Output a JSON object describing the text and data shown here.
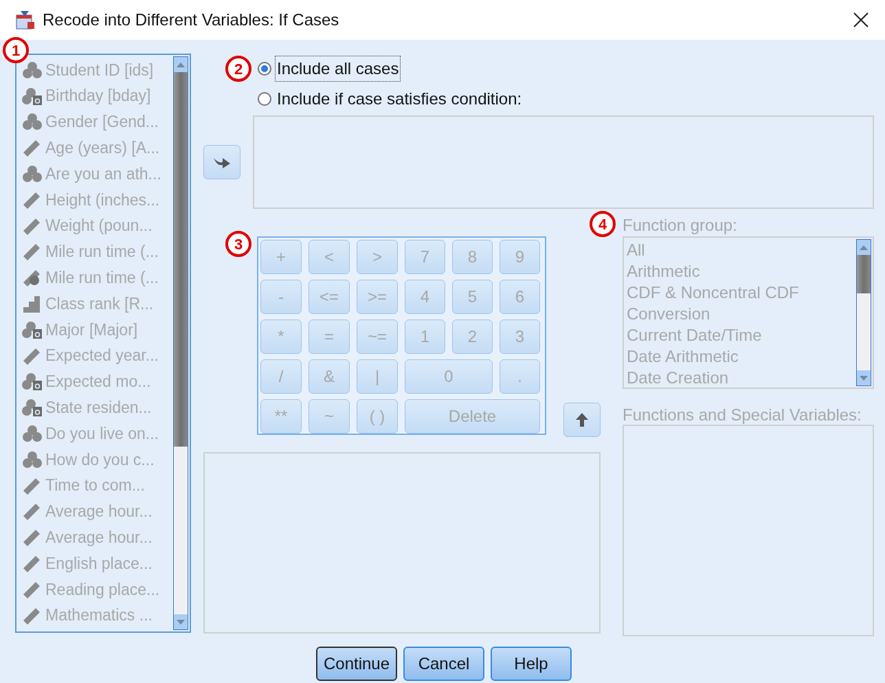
{
  "window": {
    "title": "Recode into Different Variables: If Cases"
  },
  "variables": {
    "badge": "1",
    "disabled": true,
    "items": [
      {
        "name": "Student ID [ids]",
        "kind": "nominal"
      },
      {
        "name": "Birthday [bday]",
        "kind": "string"
      },
      {
        "name": "Gender [Gend...",
        "kind": "nominal"
      },
      {
        "name": "Age (years) [A...",
        "kind": "scale"
      },
      {
        "name": "Are you an ath...",
        "kind": "nominal"
      },
      {
        "name": "Height (inches...",
        "kind": "scale"
      },
      {
        "name": "Weight (poun...",
        "kind": "scale"
      },
      {
        "name": "Mile run time (...",
        "kind": "scale"
      },
      {
        "name": "Mile run time (...",
        "kind": "date"
      },
      {
        "name": "Class rank [R...",
        "kind": "ordinal"
      },
      {
        "name": "Major [Major]",
        "kind": "string"
      },
      {
        "name": "Expected year...",
        "kind": "scale"
      },
      {
        "name": "Expected mo...",
        "kind": "string"
      },
      {
        "name": "State residen...",
        "kind": "string"
      },
      {
        "name": "Do you live on...",
        "kind": "nominal"
      },
      {
        "name": "How do you c...",
        "kind": "nominal"
      },
      {
        "name": "Time to com...",
        "kind": "scale"
      },
      {
        "name": "Average hour...",
        "kind": "scale"
      },
      {
        "name": "Average hour...",
        "kind": "scale"
      },
      {
        "name": "English place...",
        "kind": "scale"
      },
      {
        "name": "Reading place...",
        "kind": "scale"
      },
      {
        "name": "Mathematics ...",
        "kind": "scale"
      }
    ]
  },
  "case_selection": {
    "badge": "2",
    "options": [
      {
        "label": "Include all cases",
        "selected": true
      },
      {
        "label": "Include if case satisfies condition:",
        "selected": false
      }
    ]
  },
  "keypad": {
    "badge": "3",
    "disabled": true,
    "keys": [
      {
        "label": "+",
        "kind": "single"
      },
      {
        "label": "<",
        "kind": "single"
      },
      {
        "label": ">",
        "kind": "single"
      },
      {
        "label": "7",
        "kind": "single"
      },
      {
        "label": "8",
        "kind": "single"
      },
      {
        "label": "9",
        "kind": "single"
      },
      {
        "label": "-",
        "kind": "single"
      },
      {
        "label": "<=",
        "kind": "single"
      },
      {
        "label": ">=",
        "kind": "single"
      },
      {
        "label": "4",
        "kind": "single"
      },
      {
        "label": "5",
        "kind": "single"
      },
      {
        "label": "6",
        "kind": "single"
      },
      {
        "label": "*",
        "kind": "single"
      },
      {
        "label": "=",
        "kind": "single"
      },
      {
        "label": "~=",
        "kind": "single"
      },
      {
        "label": "1",
        "kind": "single"
      },
      {
        "label": "2",
        "kind": "single"
      },
      {
        "label": "3",
        "kind": "single"
      },
      {
        "label": "/",
        "kind": "single"
      },
      {
        "label": "&",
        "kind": "single"
      },
      {
        "label": "|",
        "kind": "single"
      },
      {
        "label": "0",
        "kind": "double"
      },
      {
        "label": ".",
        "kind": "single"
      },
      {
        "label": "**",
        "kind": "single"
      },
      {
        "label": "~",
        "kind": "single"
      },
      {
        "label": "( )",
        "kind": "single"
      },
      {
        "label": "Delete",
        "kind": "triple"
      }
    ]
  },
  "function_group": {
    "badge": "4",
    "label": "Function group:",
    "disabled": true,
    "items": [
      "All",
      "Arithmetic",
      "CDF & Noncentral CDF",
      "Conversion",
      "Current Date/Time",
      "Date Arithmetic",
      "Date Creation"
    ]
  },
  "functions": {
    "label": "Functions and Special Variables:",
    "disabled": true
  },
  "buttons": [
    {
      "label": "Continue",
      "default": true
    },
    {
      "label": "Cancel",
      "default": false
    },
    {
      "label": "Help",
      "default": false
    }
  ]
}
